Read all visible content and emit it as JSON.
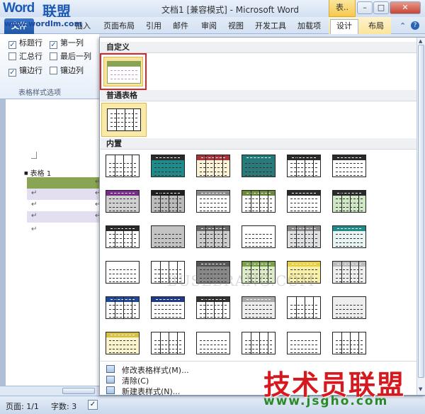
{
  "title_bar": {
    "logo_text": "Word",
    "logo_suffix": "联盟",
    "title": "文档1 [兼容模式] - Microsoft Word",
    "context_label": "表..",
    "min": "–",
    "max": "□",
    "close": "✕"
  },
  "ribbon_tabs": {
    "file": "文件",
    "url": "www.wordlm.com",
    "tabs": [
      "插入",
      "页面布局",
      "引用",
      "邮件",
      "审阅",
      "视图",
      "开发工具",
      "加载项"
    ],
    "context_tabs": [
      "设计",
      "布局"
    ],
    "selected": "设计"
  },
  "table_style_options": {
    "options": [
      {
        "label": "标题行",
        "checked": true
      },
      {
        "label": "第一列",
        "checked": true
      },
      {
        "label": "汇总行",
        "checked": false
      },
      {
        "label": "最后一列",
        "checked": false
      },
      {
        "label": "镶边行",
        "checked": true
      },
      {
        "label": "镶边列",
        "checked": false
      }
    ],
    "group_label": "表格样式选项"
  },
  "document": {
    "caption": "表格 1",
    "cell_mark": "↵",
    "para_mark": "↵"
  },
  "gallery": {
    "sections": [
      "自定义",
      "普通表格",
      "内置"
    ],
    "menu": [
      {
        "label": "修改表格样式(M)...",
        "icon": "modify-style-icon"
      },
      {
        "label": "清除(C)",
        "icon": "clear-icon"
      },
      {
        "label": "新建表样式(N)...",
        "icon": "new-style-icon"
      }
    ]
  },
  "status_bar": {
    "page": "页面: 1/1",
    "words": "字数: 3"
  },
  "watermark": "BUSEBRANG.COM",
  "brand": {
    "name": "技术员联盟",
    "url": "www.jsgho.com"
  },
  "colors": {
    "accent": "#1c5bb4",
    "header_green": "#8aa455",
    "band_lavender": "#e4dff0",
    "selection_red": "#d8272a"
  }
}
